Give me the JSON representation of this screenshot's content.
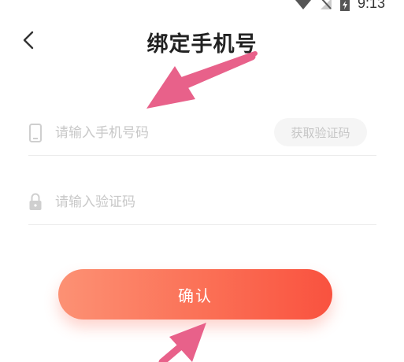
{
  "status_bar": {
    "time": "9:13",
    "icons": [
      "wifi-icon",
      "signal-icon",
      "battery-icon"
    ]
  },
  "header": {
    "back_icon": "chevron-left-icon",
    "title": "绑定手机号"
  },
  "form": {
    "phone": {
      "icon": "phone-icon",
      "placeholder": "请输入手机号码",
      "value": ""
    },
    "get_code_label": "获取验证码",
    "code": {
      "icon": "lock-icon",
      "placeholder": "请输入验证码",
      "value": ""
    }
  },
  "confirm_label": "确认",
  "colors": {
    "accent_start": "#fc9174",
    "accent_end": "#f9523f",
    "annotation_arrow": "#e8618a"
  }
}
